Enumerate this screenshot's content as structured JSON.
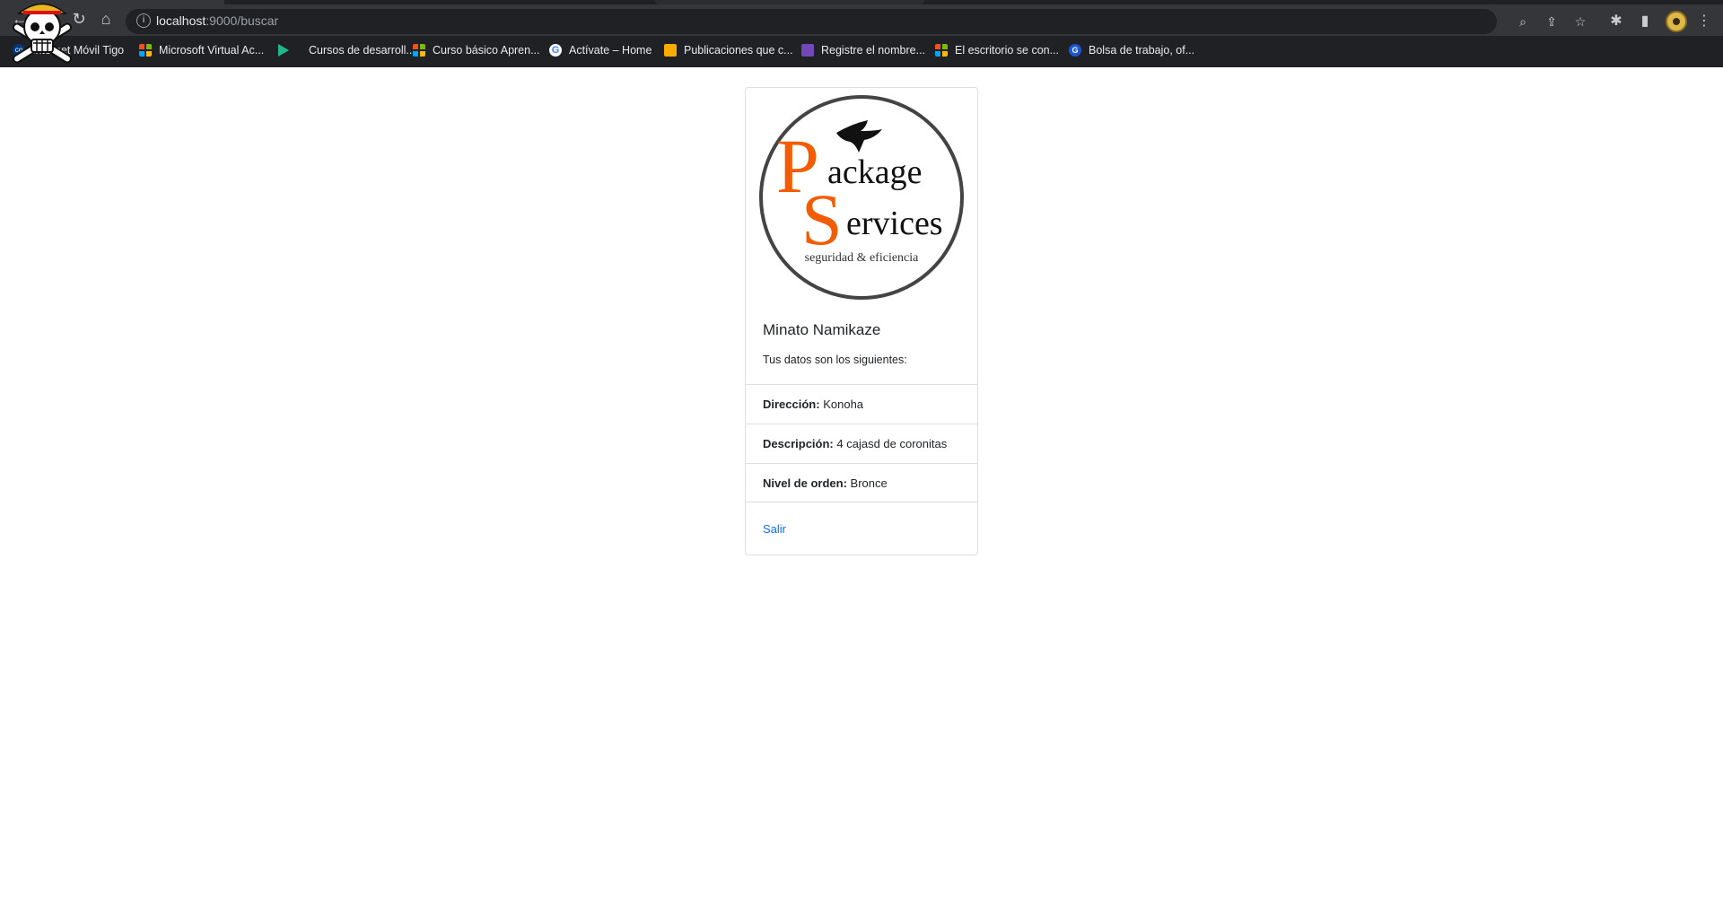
{
  "browser": {
    "url_host": "localhost",
    "url_path": ":9000/buscar",
    "bookmarks": [
      {
        "label": "Internet Móvil Tigo",
        "icon": "tigo-icon"
      },
      {
        "label": "Microsoft Virtual Ac...",
        "icon": "microsoft-icon"
      },
      {
        "label": "Cursos de desarroll...",
        "icon": "play-icon"
      },
      {
        "label": "Curso básico Apren...",
        "icon": "microsoft-icon"
      },
      {
        "label": "Actívate – Home",
        "icon": "google-icon"
      },
      {
        "label": "Publicaciones que c...",
        "icon": "publications-icon"
      },
      {
        "label": "Registre el nombre...",
        "icon": "form-icon"
      },
      {
        "label": "El escritorio se con...",
        "icon": "microsoft-icon"
      },
      {
        "label": "Bolsa de trabajo, of...",
        "icon": "bolsa-icon"
      }
    ]
  },
  "logo": {
    "word1": "ackage",
    "initial1": "P",
    "word2": "ervices",
    "initial2": "S",
    "tagline": "seguridad & eficiencia",
    "accent_color": "#f25c05"
  },
  "card": {
    "title": "Minato Namikaze",
    "subtitle": "Tus datos son los siguientes:",
    "items": [
      {
        "label": "Dirección:",
        "value": "Konoha"
      },
      {
        "label": "Descripción:",
        "value": "4 cajasd de coronitas"
      },
      {
        "label": "Nivel de orden:",
        "value": "Bronce"
      }
    ],
    "exit_link": "Salir",
    "link_color": "#0d6efd"
  }
}
